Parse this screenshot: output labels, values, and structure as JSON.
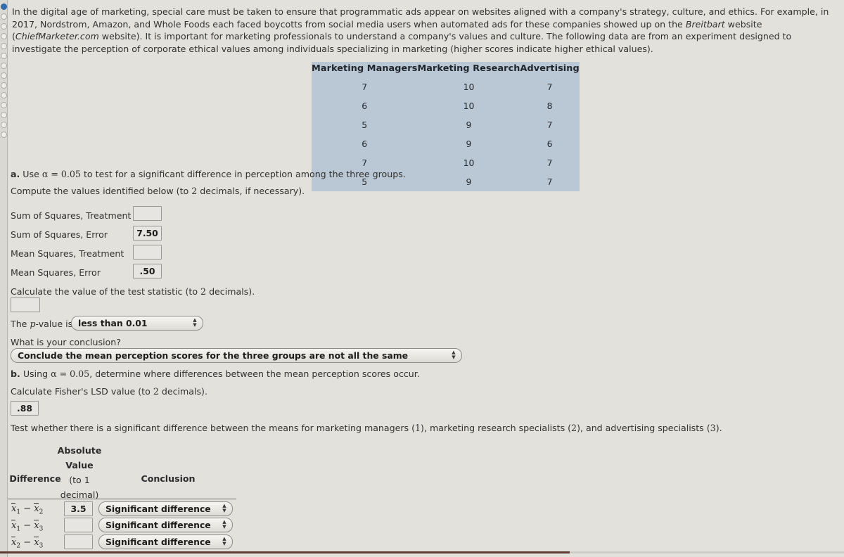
{
  "left_rail": {
    "name": "question-navigator",
    "dots": [
      "active",
      "idle",
      "idle",
      "idle",
      "idle",
      "idle",
      "idle",
      "idle",
      "idle",
      "idle",
      "idle",
      "idle",
      "idle",
      "idle"
    ]
  },
  "intro": {
    "part1": "In the digital age of marketing, special care must be taken to ensure that programmatic ads appear on websites aligned with a company's strategy, culture, and ethics. For example, in 2017, Nordstrom, Amazon, and Whole Foods each faced boycotts from social media users when automated ads for these companies showed up on the ",
    "italic1": "Breitbart",
    "part2": " website (",
    "italic2": "ChiefMarketer.com",
    "part3": " website). It is important for marketing professionals to understand a company's values and culture. The following data are from an experiment designed to investigate the perception of corporate ethical values among individuals specializing in marketing (higher scores indicate higher ethical values)."
  },
  "data_table": {
    "headers": [
      "Marketing Managers",
      "Marketing Research",
      "Advertising"
    ],
    "rows": [
      [
        "7",
        "10",
        "7"
      ],
      [
        "6",
        "10",
        "8"
      ],
      [
        "5",
        "9",
        "7"
      ],
      [
        "6",
        "9",
        "6"
      ],
      [
        "7",
        "10",
        "7"
      ],
      [
        "5",
        "9",
        "7"
      ]
    ],
    "background_color": "#b9c8d4"
  },
  "part_a": {
    "prompt_label": "a.",
    "prompt_pre": " Use ",
    "prompt_alpha": "α = 0.05",
    "prompt_post": " to test for a significant difference in perception among the three groups.",
    "compute_pre": "Compute the values identified below (to ",
    "compute_num": "2",
    "compute_post": " decimals, if necessary).",
    "fields": [
      {
        "label": "Sum of Squares, Treatment",
        "value": ""
      },
      {
        "label": "Sum of Squares, Error",
        "value": "7.50"
      },
      {
        "label": "Mean Squares, Treatment",
        "value": ""
      },
      {
        "label": "Mean Squares, Error",
        "value": ".50"
      }
    ],
    "test_stat_pre": "Calculate the value of the test statistic (to ",
    "test_stat_num": "2",
    "test_stat_post": " decimals).",
    "test_stat_value": "",
    "pvalue_label_pre": "The ",
    "pvalue_label_p": "p",
    "pvalue_label_post": "-value is",
    "pvalue_selected": "less than 0.01",
    "conclusion_question": "What is your conclusion?",
    "conclusion_selected": "Conclude the mean perception scores for the three groups are not all the same"
  },
  "part_b": {
    "prompt_label": "b.",
    "prompt_pre": " Using ",
    "prompt_alpha": "α = 0.05",
    "prompt_post": ", determine where differences between the mean perception scores occur.",
    "lsd_pre": "Calculate Fisher's LSD value (to ",
    "lsd_num": "2",
    "lsd_post": " decimals).",
    "lsd_value": ".88",
    "test_sentence_pre": "Test whether there is a significant difference between the means for marketing managers (",
    "test_n1": "1",
    "test_sentence_mid1": "), marketing research specialists (",
    "test_n2": "2",
    "test_sentence_mid2": "), and advertising specialists (",
    "test_n3": "3",
    "test_sentence_post": ").",
    "table_headers": {
      "difference": "Difference",
      "absolute_line1": "Absolute",
      "absolute_line2": "Value",
      "absolute_line3": "(to 1",
      "absolute_line4": "decimal)",
      "conclusion": "Conclusion"
    },
    "rows": [
      {
        "sub1": "1",
        "sub2": "2",
        "value": "3.5",
        "conclusion": "Significant difference"
      },
      {
        "sub1": "1",
        "sub2": "3",
        "value": "",
        "conclusion": "Significant difference"
      },
      {
        "sub1": "2",
        "sub2": "3",
        "value": "",
        "conclusion": "Significant difference"
      }
    ]
  },
  "colors": {
    "page_background": "#e2e1dc",
    "table_background": "#b9c8d4",
    "bottom_rule": "#5d3a32",
    "rail_active": "#2f6fb5"
  }
}
